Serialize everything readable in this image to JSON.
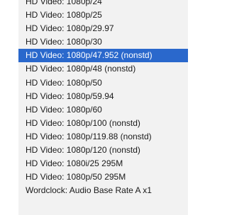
{
  "menu": {
    "selected_index": 4,
    "selection_color": "#2a68cc",
    "items": [
      {
        "label": "HD Video: 1080p/24"
      },
      {
        "label": "HD Video: 1080p/25"
      },
      {
        "label": "HD Video: 1080p/29.97"
      },
      {
        "label": "HD Video: 1080p/30"
      },
      {
        "label": "HD Video: 1080p/47.952 (nonstd)"
      },
      {
        "label": "HD Video: 1080p/48 (nonstd)"
      },
      {
        "label": "HD Video: 1080p/50"
      },
      {
        "label": "HD Video: 1080p/59.94"
      },
      {
        "label": "HD Video: 1080p/60"
      },
      {
        "label": "HD Video: 1080p/100 (nonstd)"
      },
      {
        "label": "HD Video: 1080p/119.88 (nonstd)"
      },
      {
        "label": "HD Video: 1080p/120 (nonstd)"
      },
      {
        "label": "HD Video: 1080i/25 295M"
      },
      {
        "label": "HD Video: 1080p/50 295M"
      },
      {
        "label": "Wordclock: Audio Base Rate A x1"
      }
    ]
  }
}
